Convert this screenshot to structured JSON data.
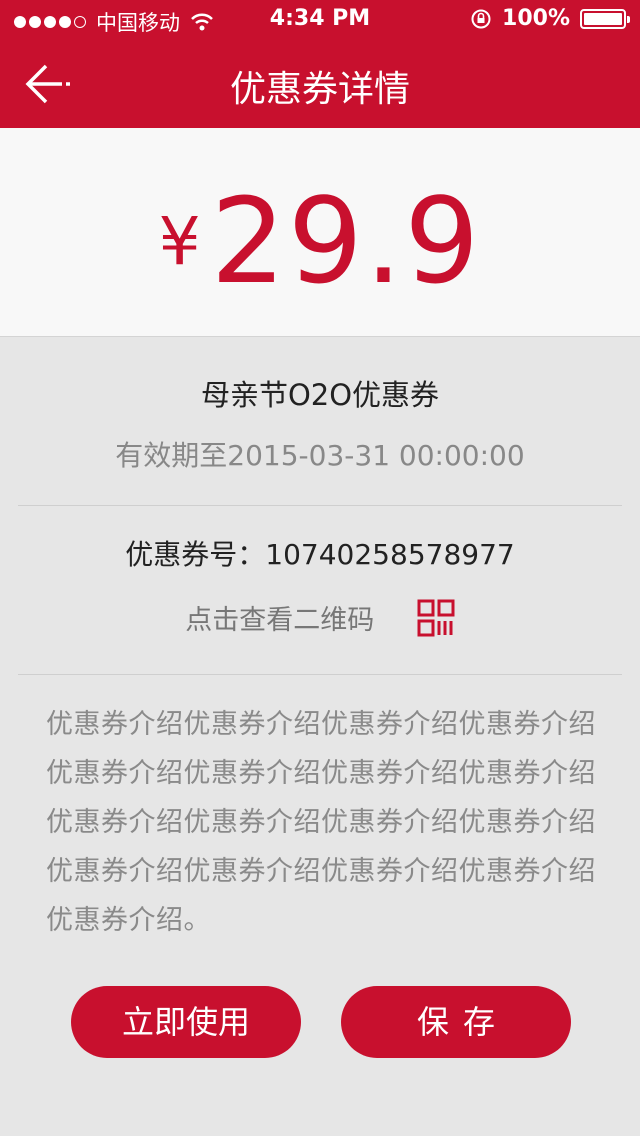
{
  "status_bar": {
    "carrier": "中国移动",
    "time": "4:34 PM",
    "battery": "100%"
  },
  "nav": {
    "title": "优惠券详情"
  },
  "coupon": {
    "currency": "¥",
    "amount": "29.9",
    "name": "母亲节O2O优惠券",
    "validity": "有效期至2015-03-31 00:00:00",
    "number_label": "优惠券号：",
    "number": "10740258578977",
    "qr_hint": "点击查看二维码",
    "intro": "优惠券介绍优惠券介绍优惠券介绍优惠券介绍优惠券介绍优惠券介绍优惠券介绍优惠券介绍优惠券介绍优惠券介绍优惠券介绍优惠券介绍优惠券介绍优惠券介绍优惠券介绍优惠券介绍优惠券介绍。"
  },
  "actions": {
    "use_label": "立即使用",
    "save_label": "保存"
  },
  "colors": {
    "brand": "#c8102e",
    "background": "#e6e6e6"
  }
}
